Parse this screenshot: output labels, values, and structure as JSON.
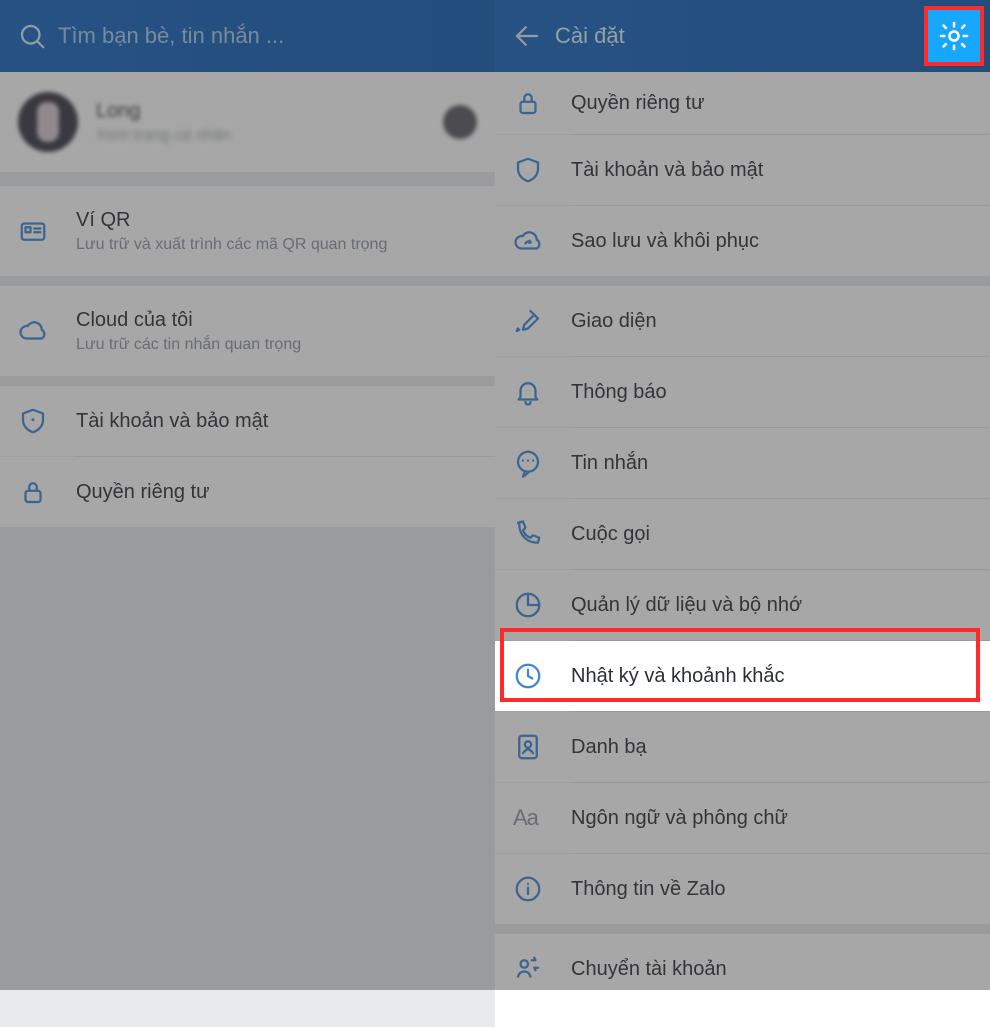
{
  "left": {
    "search_placeholder": "Tìm bạn bè, tin nhắn ...",
    "profile": {
      "name": "Long",
      "sub": "Xem trang cá nhân"
    },
    "items": {
      "qr": {
        "title": "Ví QR",
        "sub": "Lưu trữ và xuất trình các mã QR quan trọng"
      },
      "cloud": {
        "title": "Cloud của tôi",
        "sub": "Lưu trữ các tin nhắn quan trọng"
      },
      "security": {
        "title": "Tài khoản và bảo mật"
      },
      "privacy": {
        "title": "Quyền riêng tư"
      }
    }
  },
  "right": {
    "title": "Cài đặt",
    "items": {
      "privacy": "Quyền riêng tư",
      "security": "Tài khoản và bảo mật",
      "backup": "Sao lưu và khôi phục",
      "theme": "Giao diện",
      "notif": "Thông báo",
      "message": "Tin nhắn",
      "call": "Cuộc gọi",
      "data": "Quản lý dữ liệu và bộ nhớ",
      "timeline": "Nhật ký và khoảnh khắc",
      "contacts": "Danh bạ",
      "lang": "Ngôn ngữ và phông chữ",
      "about": "Thông tin về Zalo",
      "switch": "Chuyển tài khoản"
    }
  }
}
